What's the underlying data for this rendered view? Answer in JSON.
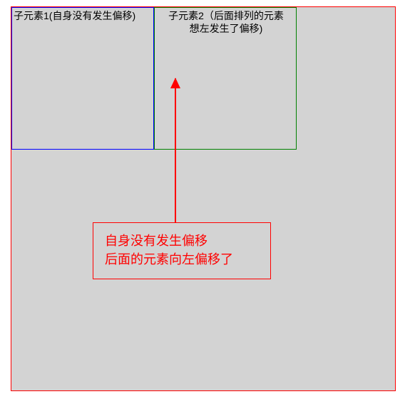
{
  "outer": {
    "desc": "outer red container"
  },
  "box1": {
    "label": "子元素1(自身没有发生偏移)"
  },
  "box2": {
    "label_line1": "子元素2（后面排列的元素",
    "label_line2": "想左发生了偏移)"
  },
  "callout": {
    "line1": "自身没有发生偏移",
    "line2": "后面的元素向左偏移了"
  }
}
